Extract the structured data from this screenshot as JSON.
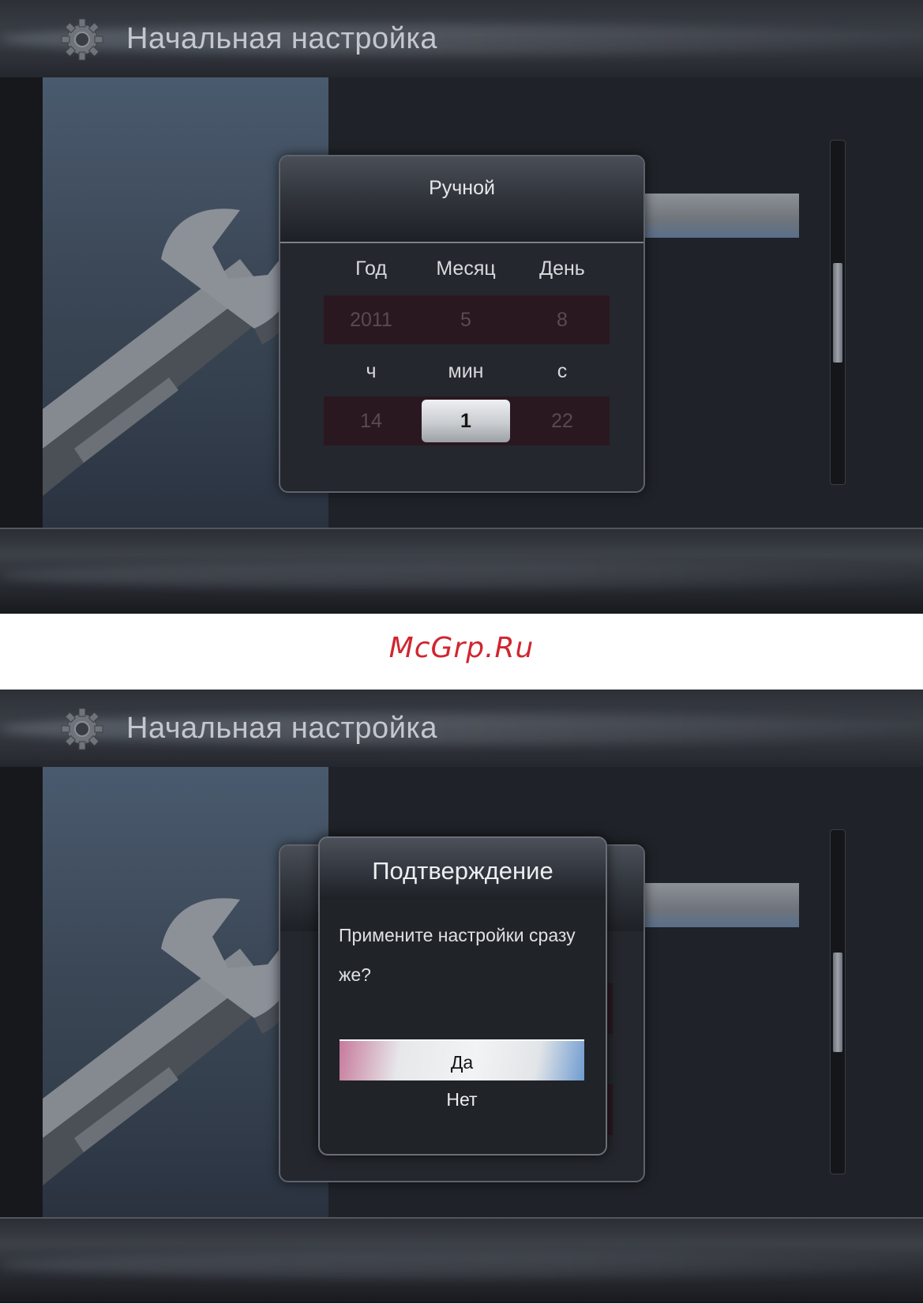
{
  "watermark": "McGrp.Ru",
  "screen1": {
    "header": {
      "title": "Начальная настройка",
      "icon": "gear-icon"
    },
    "dialog": {
      "title": "Ручной",
      "date_labels": [
        "Год",
        "Месяц",
        "День"
      ],
      "date_values": [
        "2011",
        "5",
        "8"
      ],
      "time_labels": [
        "ч",
        "мин",
        "с"
      ],
      "time_values": [
        "14",
        "1",
        "22"
      ],
      "active_field": "мин"
    }
  },
  "screen2": {
    "header": {
      "title": "Начальная настройка",
      "icon": "gear-icon"
    },
    "confirm": {
      "title": "Подтверждение",
      "message": "Примените настройки сразу же?",
      "options": [
        "Да",
        "Нет"
      ],
      "selected": "Да"
    }
  },
  "colors": {
    "watermark": "#d0262f",
    "screen_bg": "#1e2127",
    "field_bg": "#2a1820"
  }
}
